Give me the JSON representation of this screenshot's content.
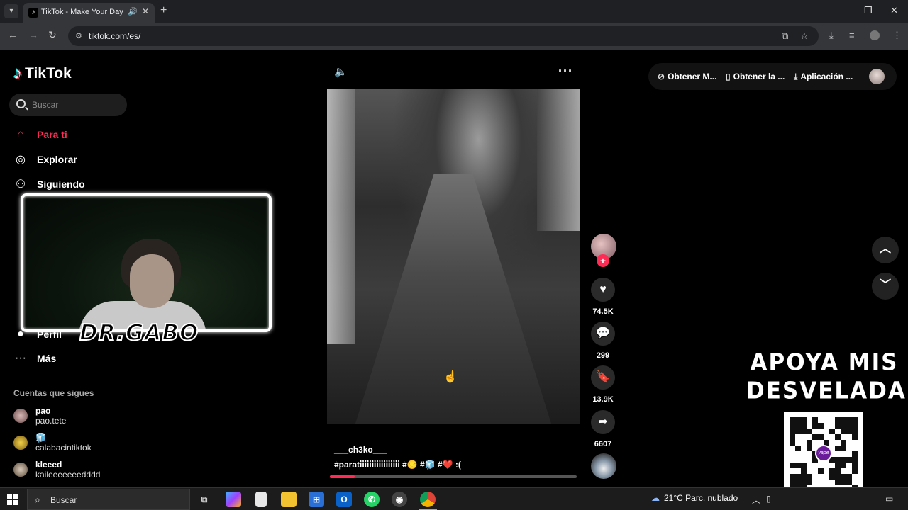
{
  "browser": {
    "tab_title": "TikTok - Make Your Day",
    "tab_favicon": "tiktok-icon",
    "url": "tiktok.com/es/",
    "new_tab": "+",
    "minimize": "—",
    "maximize": "❐",
    "close": "✕"
  },
  "sidebar": {
    "logo_text": "TikTok",
    "search_placeholder": "Buscar",
    "nav": [
      {
        "label": "Para ti",
        "icon": "home-icon"
      },
      {
        "label": "Explorar",
        "icon": "compass-icon"
      },
      {
        "label": "Siguiendo",
        "icon": "following-icon"
      },
      {
        "label": "Perfil",
        "icon": "profile-avatar"
      },
      {
        "label": "Más",
        "icon": "more-dots-icon"
      }
    ],
    "accounts_title": "Cuentas que sigues",
    "accounts": [
      {
        "name": "pao",
        "handle": "pao.tete"
      },
      {
        "name": "🧊",
        "handle": "calabacintiktok"
      },
      {
        "name": "kleeed",
        "handle": "kaileeeeeeedddd"
      }
    ]
  },
  "overlay": {
    "streamer_name": "DR.GABO",
    "support_line1": "APOYA MIS",
    "support_line2": "DESVELADAS",
    "qr_brand": "yape"
  },
  "video": {
    "username": "___ch3ko___",
    "caption": "#parati̇i̇i̇i̇i̇i̇i̇i̇i̇i̇i̇i̇i̇i̇i̇i̇i̇ #😔 #🧊 #❤️ :(",
    "progress": 0.1
  },
  "actions": {
    "likes": "74.5K",
    "comments": "299",
    "saves": "13.9K",
    "shares": "6607",
    "follow": "+"
  },
  "topbar": {
    "link1": "Obtener M...",
    "link2": "Obtener la ...",
    "link3": "Aplicación ..."
  },
  "taskbar": {
    "search_placeholder": "Buscar",
    "weather_temp": "21°C",
    "weather_desc": "Parc. nublado"
  },
  "colors": {
    "accent": "#fe2c55",
    "cyan": "#25f4ee"
  }
}
